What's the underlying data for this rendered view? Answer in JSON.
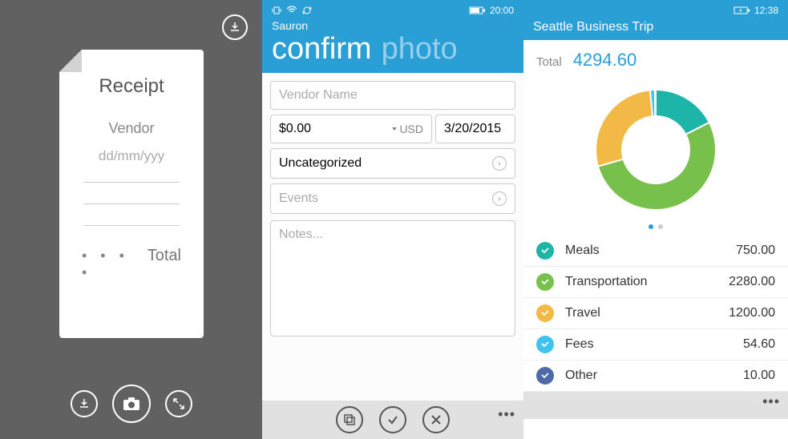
{
  "panel1": {
    "receipt_title": "Receipt",
    "vendor_placeholder": "Vendor",
    "date_placeholder": "dd/mm/yyy",
    "dots": "• • • •",
    "total_label": "Total"
  },
  "panel2": {
    "status_time": "20:00",
    "app_name": "Sauron",
    "tab_active": "confirm",
    "tab_inactive": "photo",
    "vendor_placeholder": "Vendor Name",
    "amount_value": "$0.00",
    "currency_label": "USD",
    "date_value": "3/20/2015",
    "category_value": "Uncategorized",
    "events_placeholder": "Events",
    "notes_placeholder": "Notes..."
  },
  "panel3": {
    "status_time": "12:38",
    "trip_title": "Seattle Business Trip",
    "total_label": "Total",
    "total_value": "4294.60",
    "categories": [
      {
        "name": "Meals",
        "amount": "750.00",
        "color": "#1db5a8"
      },
      {
        "name": "Transportation",
        "amount": "2280.00",
        "color": "#77c04b"
      },
      {
        "name": "Travel",
        "amount": "1200.00",
        "color": "#f3b945"
      },
      {
        "name": "Fees",
        "amount": "54.60",
        "color": "#3fc3ee"
      },
      {
        "name": "Other",
        "amount": "10.00",
        "color": "#4f6aa8"
      }
    ]
  },
  "chart_data": {
    "type": "pie",
    "title": "Seattle Business Trip",
    "series": [
      {
        "name": "Meals",
        "value": 750.0,
        "color": "#1db5a8"
      },
      {
        "name": "Transportation",
        "value": 2280.0,
        "color": "#77c04b"
      },
      {
        "name": "Travel",
        "value": 1200.0,
        "color": "#f3b945"
      },
      {
        "name": "Fees",
        "value": 54.6,
        "color": "#3fc3ee"
      },
      {
        "name": "Other",
        "value": 10.0,
        "color": "#4f6aa8"
      }
    ],
    "total": 4294.6
  }
}
